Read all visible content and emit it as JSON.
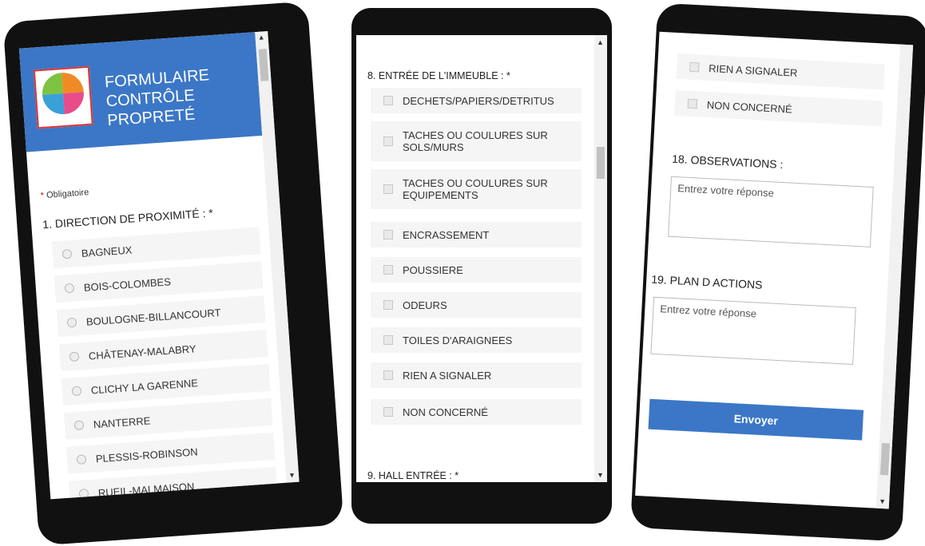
{
  "phone1": {
    "header_title_line1": "FORMULAIRE",
    "header_title_line2": "CONTRÔLE PROPRETÉ",
    "required_star": "*",
    "required_label": "Obligatoire",
    "question1": "1. DIRECTION DE PROXIMITÉ : *",
    "options": [
      "BAGNEUX",
      "BOIS-COLOMBES",
      "BOULOGNE-BILLANCOURT",
      "CHÂTENAY-MALABRY",
      "CLICHY LA GARENNE",
      "NANTERRE",
      "PLESSIS-ROBINSON",
      "RUEIL-MALMAISON"
    ]
  },
  "phone2": {
    "question8": "8. ENTRÉE DE L'IMMEUBLE : *",
    "options": [
      [
        "DECHETS/PAPIERS/DETRITUS"
      ],
      [
        "TACHES OU COULURES SUR",
        "SOLS/MURS"
      ],
      [
        "TACHES OU COULURES SUR",
        "EQUIPEMENTS"
      ],
      [
        "ENCRASSEMENT"
      ],
      [
        "POUSSIERE"
      ],
      [
        "ODEURS"
      ],
      [
        "TOILES D'ARAIGNEES"
      ],
      [
        "RIEN A SIGNALER"
      ],
      [
        "NON CONCERNÉ"
      ]
    ],
    "question9": "9. HALL ENTRÉE : *"
  },
  "phone3": {
    "options": [
      "RIEN A SIGNALER",
      "NON CONCERNÉ"
    ],
    "question18": "18. OBSERVATIONS :",
    "placeholder18": "Entrez votre réponse",
    "question19": "19. PLAN D ACTIONS",
    "placeholder19": "Entrez votre réponse",
    "submit_label": "Envoyer"
  },
  "colors": {
    "accent": "#3b77c6",
    "phone_frame": "#111111",
    "option_bg": "#f5f5f5",
    "required": "#cc0000"
  }
}
